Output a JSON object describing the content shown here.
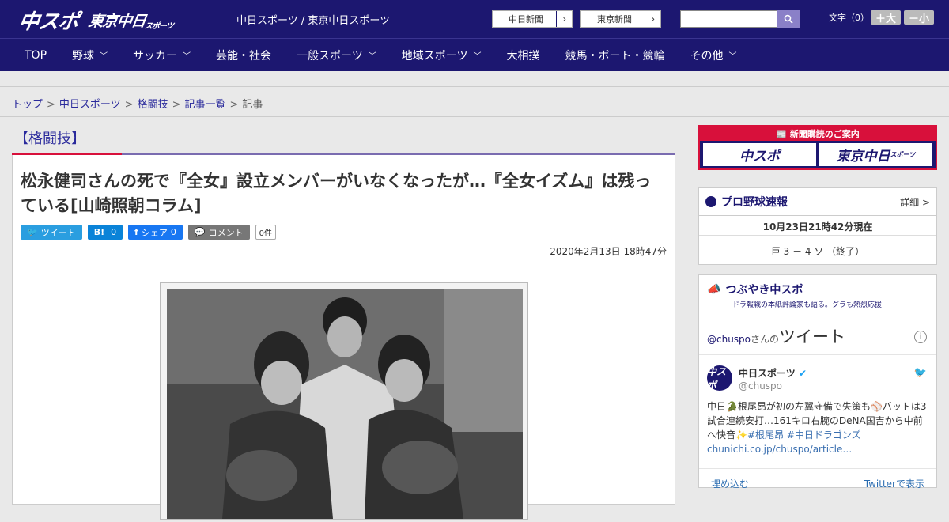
{
  "header": {
    "logo_chuspo": "中スポ",
    "logo_tokyo": "東京中日",
    "logo_tokyo_small": "スポーツ",
    "site_links": "中日スポーツ / 東京中日スポーツ",
    "paper_buttons": [
      {
        "label": "中日新聞",
        "arrow": "›"
      },
      {
        "label": "東京新聞",
        "arrow": "›"
      }
    ],
    "search_placeholder": "",
    "font_label": "文字（0）",
    "font_bigger": "＋大",
    "font_smaller": "－小"
  },
  "nav": [
    {
      "label": "TOP",
      "chevron": ""
    },
    {
      "label": "野球",
      "chevron": "﹀"
    },
    {
      "label": "サッカー",
      "chevron": "﹀"
    },
    {
      "label": "芸能・社会",
      "chevron": ""
    },
    {
      "label": "一般スポーツ",
      "chevron": "﹀"
    },
    {
      "label": "地域スポーツ",
      "chevron": "﹀"
    },
    {
      "label": "大相撲",
      "chevron": ""
    },
    {
      "label": "競馬・ボート・競輪",
      "chevron": ""
    },
    {
      "label": "その他",
      "chevron": "﹀"
    }
  ],
  "breadcrumb": {
    "items": [
      "トップ",
      "中日スポーツ",
      "格闘技",
      "記事一覧"
    ],
    "current": "記事",
    "sep": ">"
  },
  "article": {
    "category": "【格闘技】",
    "title": "松永健司さんの死で『全女』設立メンバーがいなくなったが…『全女イズム』は残っている[山崎照朝コラム]",
    "share": {
      "tweet": "ツイート",
      "hatena": "B!",
      "hatena_count": "0",
      "facebook": "シェア",
      "facebook_count": "0",
      "comment": "コメント",
      "comment_count": "0件"
    },
    "date": "2020年2月13日 18時47分"
  },
  "sidebar": {
    "subscribe": {
      "header": "新聞購読のご案内",
      "left": "中スポ",
      "right": "東京中日",
      "right_small": "スポーツ"
    },
    "baseball": {
      "title": "プロ野球速報",
      "more": "詳細 >",
      "time": "10月23日21時42分現在",
      "score": "巨 3 － 4 ソ （終了）"
    },
    "twitter": {
      "title": "つぶやき中スポ",
      "subtitle": "ドラ報戦の本紙評論家も語る。グラも熱烈応援",
      "handle_prefix": "@chuspo",
      "handle_suffix": "さんの",
      "tweets_label": "ツイート",
      "info": "i",
      "avatar": "中スポ",
      "name": "中日スポーツ",
      "handle": "@chuspo",
      "text_a": "中日🐊根尾昂が初の左翼守備で失策も⚾バットは3試合連続安打…161キロ右腕のDeNA国吉から中前へ快音✨",
      "text_tags": "#根尾昂 #中日ドラゴンズ",
      "text_link": "chunichi.co.jp/chuspo/article…",
      "embed": "埋め込む",
      "view_on": "Twitterで表示"
    }
  }
}
